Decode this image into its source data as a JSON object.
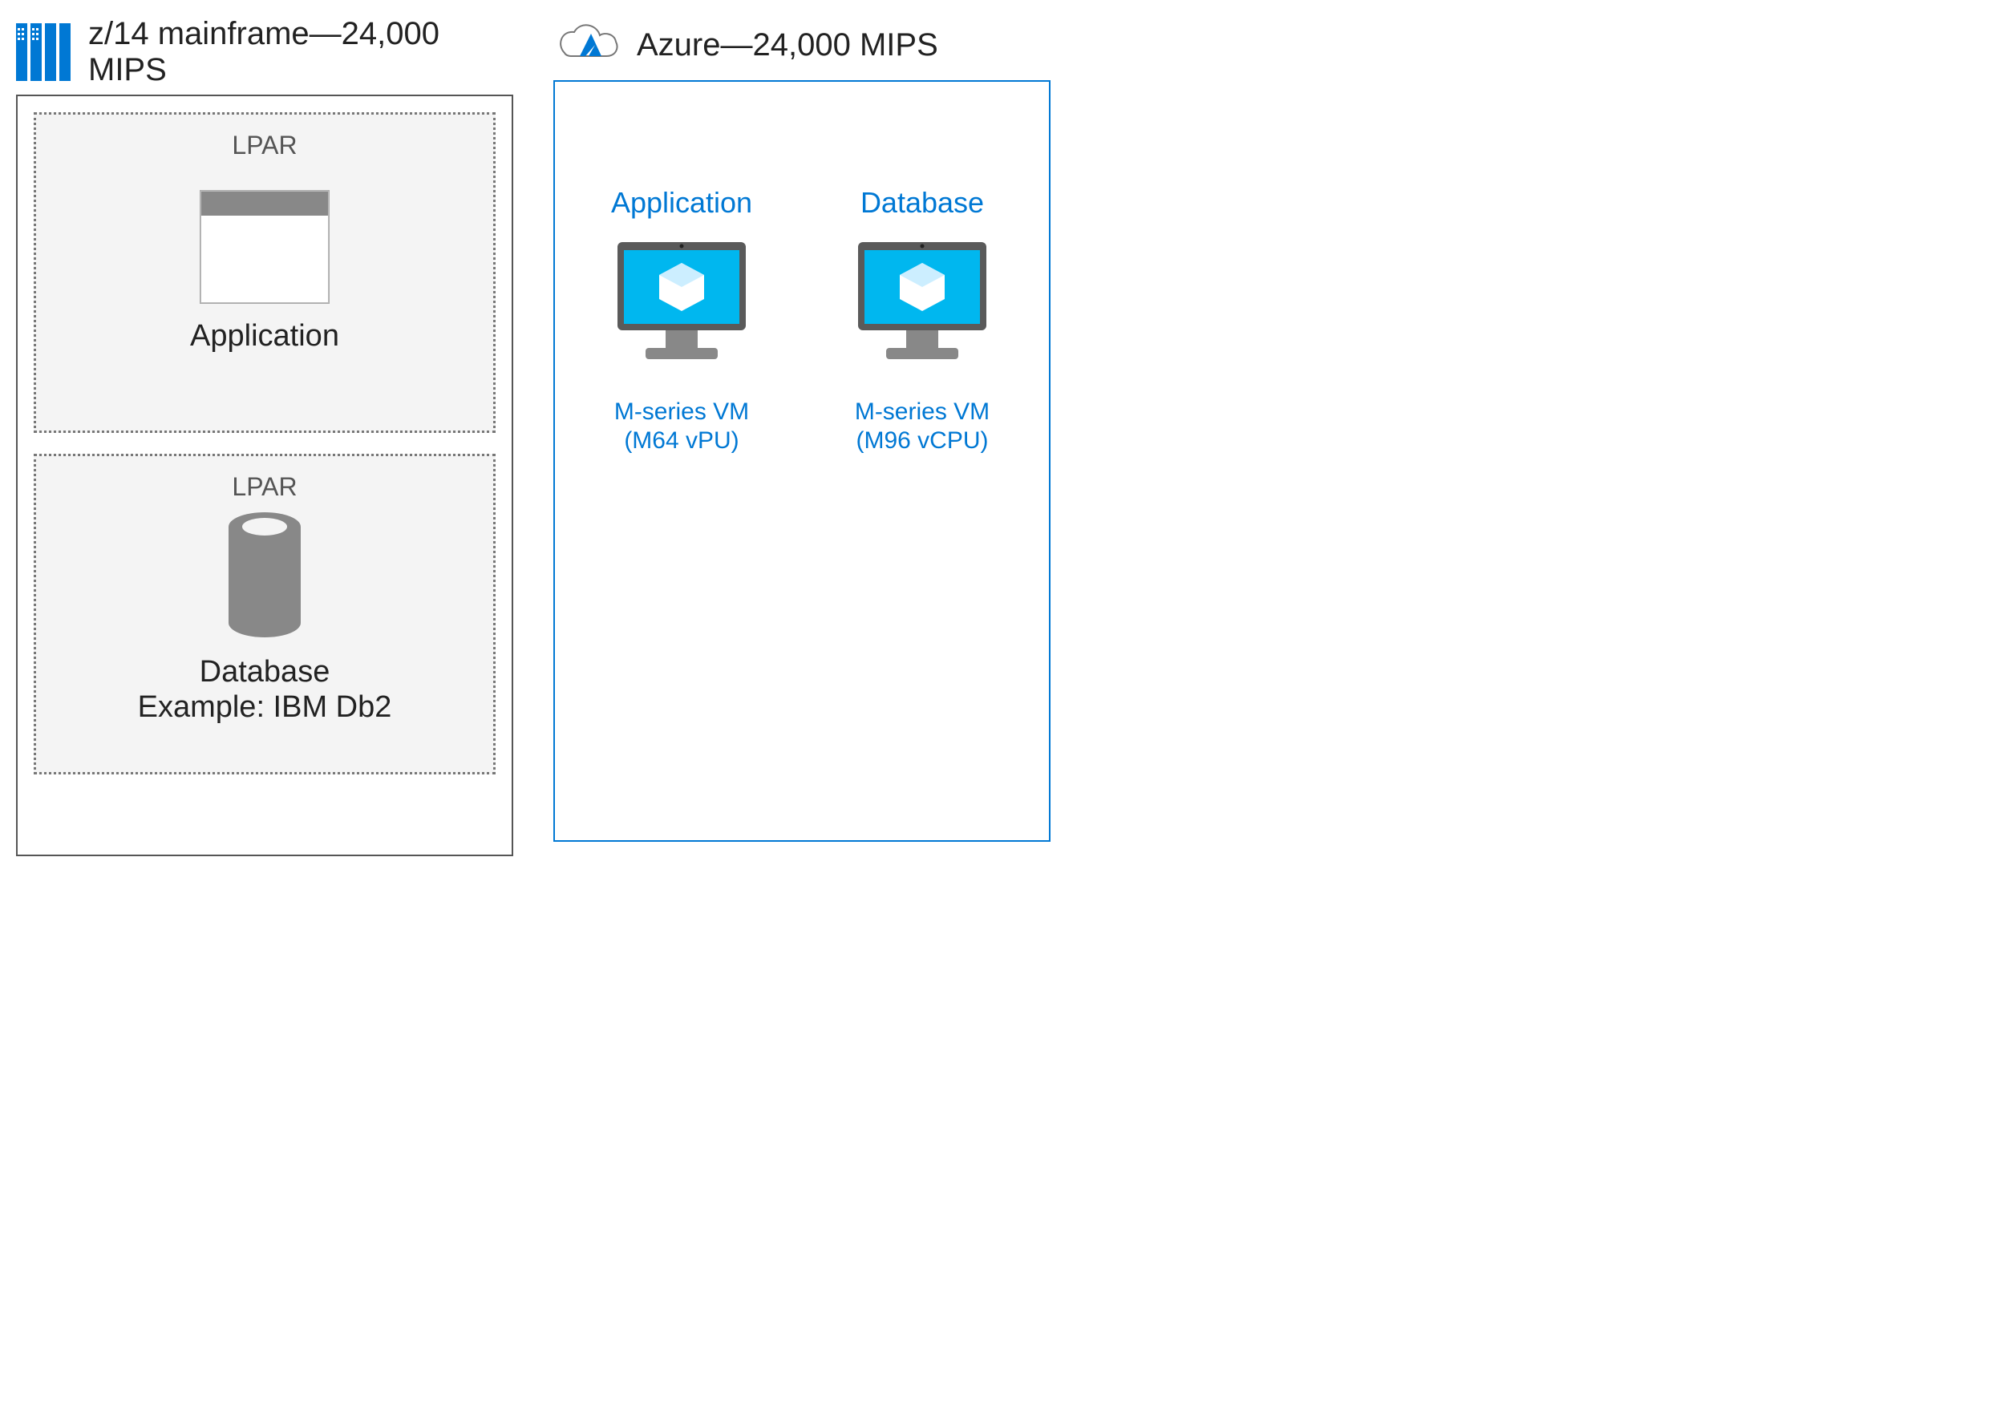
{
  "mainframe": {
    "title": "z/14 mainframe—24,000 MIPS",
    "lpars": [
      {
        "lpar_label": "LPAR",
        "caption": "Application"
      },
      {
        "lpar_label": "LPAR",
        "caption_line1": "Database",
        "caption_line2": "Example: IBM Db2"
      }
    ]
  },
  "azure": {
    "title": "Azure—24,000 MIPS",
    "items": [
      {
        "top": "Application",
        "bottom_line1": "M-series VM",
        "bottom_line2": "(M64 vPU)"
      },
      {
        "top": "Database",
        "bottom_line1": "M-series VM",
        "bottom_line2": "(M96 vCPU)"
      }
    ]
  }
}
